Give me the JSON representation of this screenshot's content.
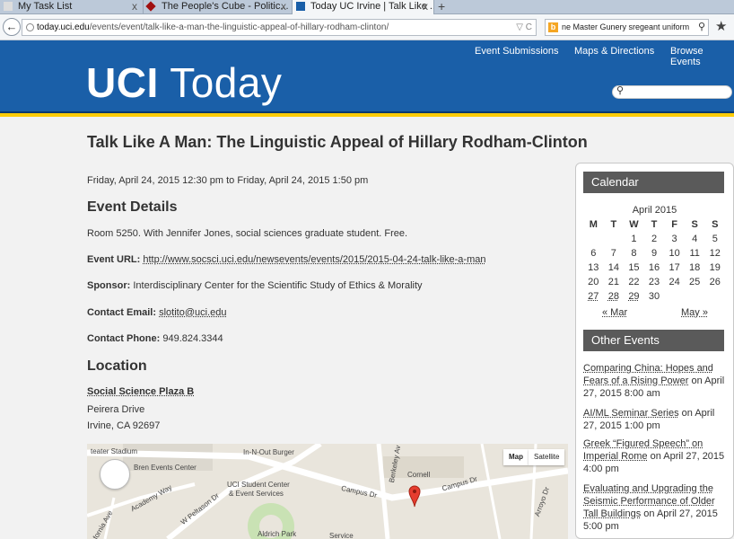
{
  "browser": {
    "tabs": [
      {
        "title": "My Task List",
        "active": false
      },
      {
        "title": "The People's Cube - Politic...",
        "active": false
      },
      {
        "title": "Today UC Irvine | Talk Like ...",
        "active": true
      }
    ],
    "url_host": "today.uci.edu",
    "url_path": "/events/event/talk-like-a-man-the-linguistic-appeal-of-hillary-rodham-clinton/",
    "search_text": "ne Master Gunery sregeant uniform",
    "new_tab": "+",
    "close_glyph": "x",
    "back_glyph": "←",
    "url_right_glyph": "▽ C",
    "search_glyph": "⚲",
    "star_glyph": "★"
  },
  "header": {
    "nav": [
      "Event Submissions",
      "Maps & Directions",
      "Browse Events"
    ],
    "logo_bold": "UCI",
    "logo_light": "Today",
    "colors": {
      "blue": "#1a5fa8",
      "gold": "#fecc07"
    }
  },
  "event": {
    "title": "Talk Like A Man: The Linguistic Appeal of Hillary Rodham-Clinton",
    "datetime": "Friday, April 24, 2015 12:30 pm to Friday, April 24, 2015 1:50 pm",
    "details_heading": "Event Details",
    "description": "Room 5250. With Jennifer Jones, social sciences graduate student. Free.",
    "url_label": "Event URL:",
    "url": "http://www.socsci.uci.edu/newsevents/events/2015/2015-04-24-talk-like-a-man",
    "sponsor_label": "Sponsor:",
    "sponsor": "Interdisciplinary Center for the Scientific Study of Ethics & Morality",
    "email_label": "Contact Email:",
    "email": "slotito@uci.edu",
    "phone_label": "Contact Phone:",
    "phone": "949.824.3344",
    "location_heading": "Location",
    "location_name": "Social Science Plaza B",
    "address1": "Peirera Drive",
    "address2": "Irvine, CA 92697"
  },
  "map": {
    "map_btn": "Map",
    "satellite_btn": "Satellite",
    "labels": [
      "teater Stadium",
      "Bren Events Center",
      "In-N-Out Burger",
      "UCI Student Center",
      "& Event Services",
      "Campus Dr",
      "Campus Dr",
      "W Peltason Dr",
      "Berkeley Av",
      "Cornell",
      "Arroyo Dr",
      "Aldrich Park",
      "Service",
      "Academy Way",
      "fornia Ave"
    ]
  },
  "calendar": {
    "heading": "Calendar",
    "month": "April 2015",
    "weekdays": [
      "M",
      "T",
      "W",
      "T",
      "F",
      "S",
      "S"
    ],
    "weeks": [
      [
        "",
        "",
        "1",
        "2",
        "3",
        "4",
        "5"
      ],
      [
        "6",
        "7",
        "8",
        "9",
        "10",
        "11",
        "12"
      ],
      [
        "13",
        "14",
        "15",
        "16",
        "17",
        "18",
        "19"
      ],
      [
        "20",
        "21",
        "22",
        "23",
        "24",
        "25",
        "26"
      ],
      [
        "27",
        "28",
        "29",
        "30",
        "",
        "",
        ""
      ]
    ],
    "event_days": [
      "27",
      "28",
      "29"
    ],
    "prev": "« Mar",
    "next": "May »"
  },
  "other_events": {
    "heading": "Other Events",
    "items": [
      {
        "title": "Comparing China: Hopes and Fears of a Rising Power",
        "when": "on April 27, 2015 8:00 am"
      },
      {
        "title": "AI/ML Seminar Series",
        "when": "on April 27, 2015 1:00 pm"
      },
      {
        "title": "Greek “Figured Speech” on Imperial Rome",
        "when": "on April 27, 2015 4:00 pm"
      },
      {
        "title": "Evaluating and Upgrading the Seismic Performance of Older Tall Buildings",
        "when": "on April 27, 2015 5:00 pm"
      }
    ]
  }
}
